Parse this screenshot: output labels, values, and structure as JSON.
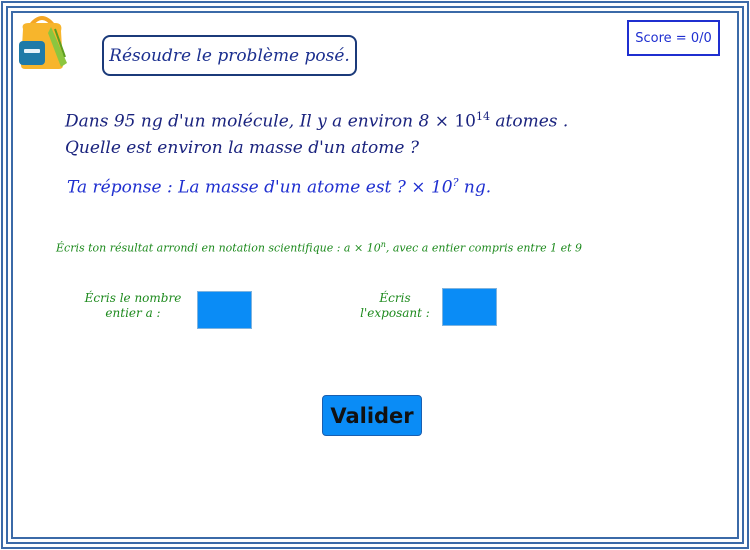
{
  "header": {
    "instruction": "Résoudre le problème posé.",
    "score": "Score = 0/0"
  },
  "problem": {
    "line1_start": "Dans 95 ng d'un molécule,  Il y a environ 8",
    "times": "×",
    "base": "10",
    "exponent": "14",
    "line1_end": "atomes .",
    "line2": "Quelle est environ la masse d'un atome ?"
  },
  "answer": {
    "prefix": "Ta réponse :  La masse d'un atome est ? × 10",
    "exponent": "?",
    "suffix": "ng."
  },
  "hint": {
    "start": "Écris ton résultat arrondi en notation scientifique : a × 10",
    "exponent": "n",
    "end": ", avec a entier compris entre 1 et 9"
  },
  "inputs": {
    "a_label_line1": "Écris le nombre",
    "a_label_line2": "entier a :",
    "exp_label_line1": "Écris",
    "exp_label_line2": "l'exposant :",
    "a_value": "",
    "exp_value": ""
  },
  "buttons": {
    "validate": "Valider"
  },
  "icons": {
    "logo": "backpack-icon"
  },
  "colors": {
    "frame": "#3b6aa8",
    "input_fill": "#0a8cf6",
    "hint_text": "#1d8a1d",
    "problem_text": "#1a237e",
    "score_border": "#1f2fd0"
  }
}
